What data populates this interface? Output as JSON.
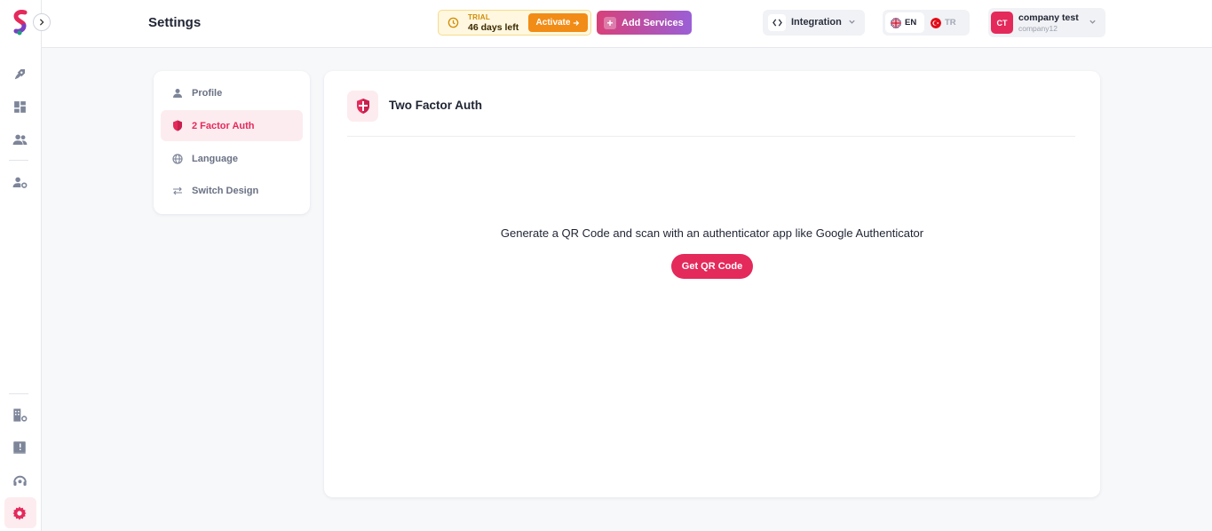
{
  "header": {
    "title": "Settings",
    "trial": {
      "label": "TRIAL",
      "days": "46 days left",
      "activate": "Activate"
    },
    "add_services": "Add Services",
    "integration": "Integration",
    "languages": [
      {
        "code": "EN",
        "active": true
      },
      {
        "code": "TR",
        "active": false
      }
    ],
    "user": {
      "initials": "CT",
      "name": "company test",
      "company": "company12"
    }
  },
  "sidebar": {
    "icons": [
      "rocket-icon",
      "dashboard-icon",
      "users-icon",
      "user-settings-icon",
      "building-settings-icon",
      "book-icon",
      "support-icon",
      "settings-icon"
    ],
    "active": "settings-icon"
  },
  "settings_nav": {
    "items": [
      {
        "label": "Profile",
        "icon": "user-icon",
        "active": false
      },
      {
        "label": "2 Factor Auth",
        "icon": "shield-icon",
        "active": true
      },
      {
        "label": "Language",
        "icon": "globe-icon",
        "active": false
      },
      {
        "label": "Switch Design",
        "icon": "swap-icon",
        "active": false
      }
    ]
  },
  "main": {
    "title": "Two Factor Auth",
    "description": "Generate a QR Code and scan with an authenticator app like Google Authenticator",
    "button": "Get QR Code"
  },
  "colors": {
    "accent": "#e4295b",
    "accent_light": "#fdecef",
    "trial_orange": "#f18c16"
  }
}
